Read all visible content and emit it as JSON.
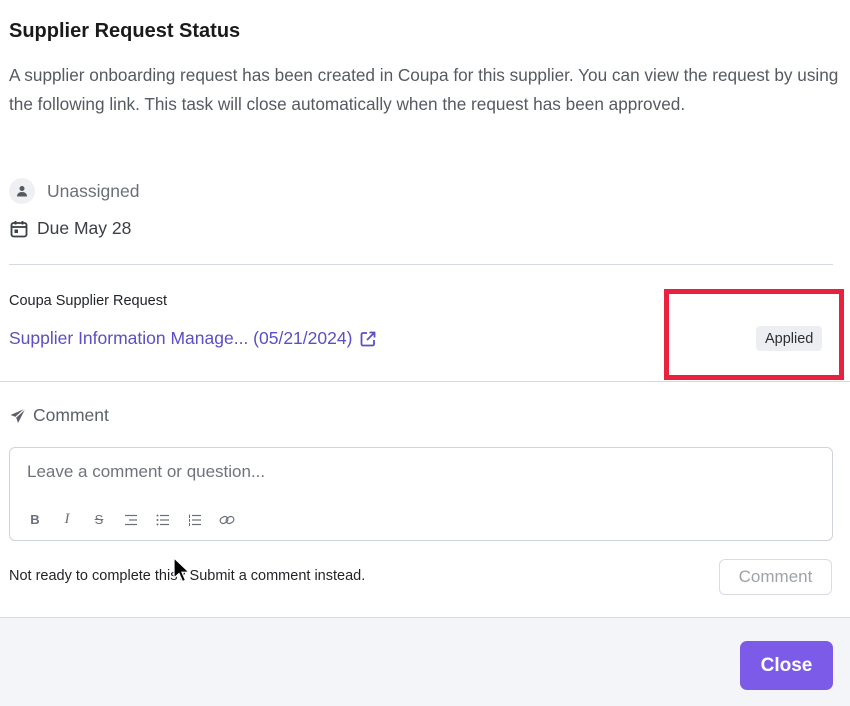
{
  "dialog": {
    "title": "Supplier Request Status",
    "description": "A supplier onboarding request has been created in Coupa for this supplier. You can view the request by using the following link. This task will close automatically when the request has been approved."
  },
  "meta": {
    "assignee": "Unassigned",
    "assignee_icon": "user-icon",
    "due": "Due May 28",
    "due_icon": "calendar-icon"
  },
  "request": {
    "label": "Coupa Supplier Request",
    "link_text": "Supplier Information Manage... (05/21/2024)",
    "link_icon": "external-link-icon",
    "status_badge": "Applied"
  },
  "comment": {
    "heading": "Comment",
    "heading_icon": "send-icon",
    "placeholder": "Leave a comment or question...",
    "toolbar": [
      "B",
      "I",
      "S",
      "indent",
      "bullet-list",
      "numbered-list",
      "link"
    ],
    "prompt_text": "Not ready to complete this? Submit a comment instead.",
    "submit_label": "Comment"
  },
  "footer": {
    "close_label": "Close"
  },
  "colors": {
    "link": "#5b4fc4",
    "primary_button": "#7b5be8",
    "highlight": "#e8213f"
  }
}
